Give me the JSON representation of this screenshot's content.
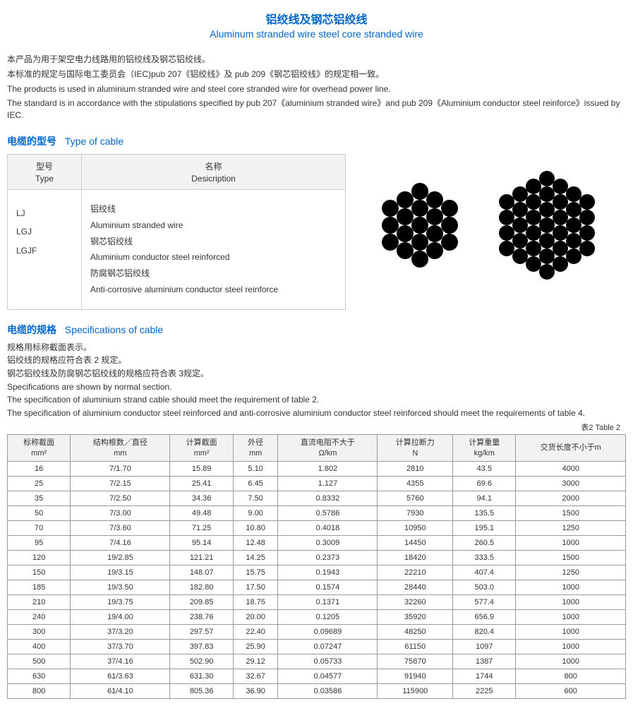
{
  "title": {
    "cn": "铝绞线及钢芯铝绞线",
    "en": "Aluminum stranded wire steel core stranded wire"
  },
  "intro": [
    "本产品为用于架空电力线路用的铝绞线及钢芯铝绞线。",
    "本标准的规定与国际电工委员会（IEC)pub 207《铝绞线》及 pub 209《钢芯铝绞线》的规定相一致。",
    "The products is used in aluminium stranded wire and steel core stranded wire for overhead power line.",
    "The standard is in accordance with the   stipulations specified by pub 207《aluminium stranded wire》and pub 209《Aluminium conductor steel reinforce》issued by IEC."
  ],
  "typeHeading": {
    "cn": "电缆的型号",
    "en": "Type of cable"
  },
  "typeHeaders": {
    "type": {
      "cn": "型号",
      "en": "Type"
    },
    "desc": {
      "cn": "名称",
      "en": "Desicription"
    }
  },
  "typeCodes": [
    "LJ",
    "LGJ",
    "LGJF"
  ],
  "typeDescriptions": [
    "铝绞线",
    "Aluminium stranded wire",
    "钢芯铝绞线",
    "Aluminium conductor steel reinforced",
    "防腐钢芯铝绞线",
    "Anti-corrosive aluminium conductor steel reinforce"
  ],
  "specHeading": {
    "cn": "电缆的规格",
    "en": "Specifications of cable"
  },
  "specIntro": [
    "规格用标称截面表示。",
    "铝绞线的规格应符合表 2 规定。",
    "钢芯铝绞线及防腐钢芯铝绞线的规格应符合表 3规定。",
    "Specifications are shown by normal section.",
    "The specification of aluminium strand cable should meet the requirement of table 2.",
    "The specification of aluminium conductor steel reinforced and anti-corrosive aluminium conductor steel reinforced should meet the requirements of table 4."
  ],
  "tableLabel": "表2   Table 2",
  "columns": [
    {
      "l1": "标称截面",
      "l2": "mm²"
    },
    {
      "l1": "结构根数／直径",
      "l2": "mm"
    },
    {
      "l1": "计算截面",
      "l2": "mm²"
    },
    {
      "l1": "外径",
      "l2": "mm"
    },
    {
      "l1": "直流电阻不大于",
      "l2": "Ω/km"
    },
    {
      "l1": "计算拉断力",
      "l2": "N"
    },
    {
      "l1": "计算重量",
      "l2": "kg/km"
    },
    {
      "l1": "交货长度不小于m",
      "l2": ""
    }
  ],
  "rows": [
    [
      "16",
      "7/1.70",
      "15.89",
      "5.10",
      "1.802",
      "2810",
      "43.5",
      "4000"
    ],
    [
      "25",
      "7/2.15",
      "25.41",
      "6.45",
      "1.127",
      "4355",
      "69.6",
      "3000"
    ],
    [
      "35",
      "7/2.50",
      "34.36",
      "7.50",
      "0.8332",
      "5760",
      "94.1",
      "2000"
    ],
    [
      "50",
      "7/3.00",
      "49.48",
      "9.00",
      "0.5786",
      "7930",
      "135.5",
      "1500"
    ],
    [
      "70",
      "7/3.60",
      "71.25",
      "10.80",
      "0.4018",
      "10950",
      "195.1",
      "1250"
    ],
    [
      "95",
      "7/4.16",
      "95.14",
      "12.48",
      "0.3009",
      "14450",
      "260.5",
      "1000"
    ],
    [
      "120",
      "19/2.85",
      "121.21",
      "14.25",
      "0.2373",
      "18420",
      "333.5",
      "1500"
    ],
    [
      "150",
      "19/3.15",
      "148.07",
      "15.75",
      "0.1943",
      "22210",
      "407.4",
      "1250"
    ],
    [
      "185",
      "19/3.50",
      "182.80",
      "17.50",
      "0.1574",
      "28440",
      "503.0",
      "1000"
    ],
    [
      "210",
      "19/3.75",
      "209.85",
      "18.75",
      "0.1371",
      "32260",
      "577.4",
      "1000"
    ],
    [
      "240",
      "19/4.00",
      "238.76",
      "20.00",
      "0.1205",
      "35920",
      "656.9",
      "1000"
    ],
    [
      "300",
      "37/3.20",
      "297.57",
      "22.40",
      "0.09689",
      "48250",
      "820.4",
      "1000"
    ],
    [
      "400",
      "37/3.70",
      "397.83",
      "25.90",
      "0.07247",
      "61150",
      "1097",
      "1000"
    ],
    [
      "500",
      "37/4.16",
      "502.90",
      "29.12",
      "0.05733",
      "75870",
      "1387",
      "1000"
    ],
    [
      "630",
      "61/3.63",
      "631.30",
      "32.67",
      "0.04577",
      "91940",
      "1744",
      "800"
    ],
    [
      "800",
      "61/4.10",
      "805.36",
      "36.90",
      "0.03586",
      "115900",
      "2225",
      "600"
    ]
  ]
}
